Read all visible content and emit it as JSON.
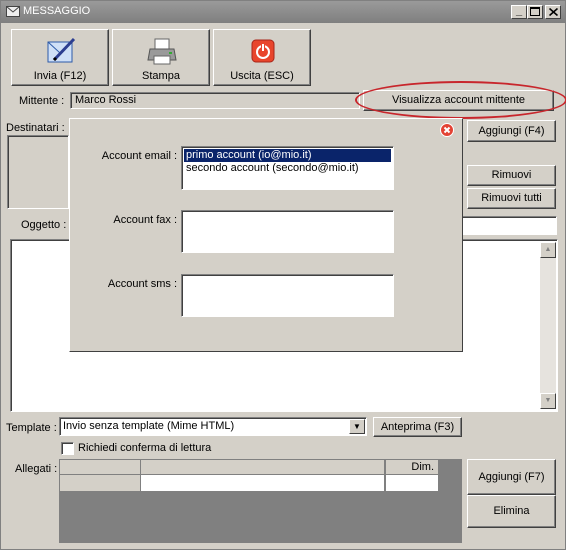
{
  "window": {
    "title": "MESSAGGIO",
    "controls": {
      "minimize": "_",
      "maximize": "□",
      "close": "✕"
    }
  },
  "toolbar": {
    "send_label": "Invia (F12)",
    "print_label": "Stampa",
    "exit_label": "Uscita (ESC)"
  },
  "form": {
    "sender_label": "Mittente :",
    "sender_value": "Marco Rossi",
    "show_sender_account_label": "Visualizza account mittente",
    "recipients_label": "Destinatari :",
    "add_recipient_label": "Aggiungi (F4)",
    "remove_label": "Rimuovi",
    "remove_all_label": "Rimuovi tutti",
    "subject_label": "Oggetto :",
    "template_label": "Template :",
    "template_value": "Invio senza template (Mime HTML)",
    "preview_label": "Anteprima (F3)",
    "read_receipt_label": "Richiedi conferma di lettura",
    "read_receipt_checked": false,
    "attachments_label": "Allegati :",
    "attachments_columns": [
      "",
      "",
      "Dim."
    ],
    "add_attachment_label": "Aggiungi (F7)",
    "delete_attachment_label": "Elimina"
  },
  "popup": {
    "email_account_label": "Account email :",
    "email_accounts": [
      {
        "text": "primo account (io@mio.it)",
        "selected": true
      },
      {
        "text": "secondo account (secondo@mio.it)",
        "selected": false
      }
    ],
    "fax_account_label": "Account fax :",
    "sms_account_label": "Account sms :"
  },
  "colors": {
    "selection": "#0a246a",
    "highlight_ellipse": "#c8262c",
    "exit_icon": "#e8452c"
  }
}
